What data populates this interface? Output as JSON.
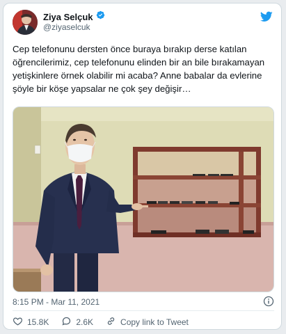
{
  "author": {
    "name": "Ziya Selçuk",
    "handle": "@ziyaselcuk",
    "verified": true
  },
  "tweet": {
    "text": "Cep telefonunu dersten önce buraya bırakıp derse katılan öğrencilerimiz, cep telefonunu elinden bir an bile bırakamayan yetişkinlere örnek olabilir mi acaba? Anne babalar da evlerine şöyle bir köşe yapsalar ne çok şey değişir…",
    "timestamp": "8:15 PM - Mar 11, 2021"
  },
  "actions": {
    "likes": "15.8K",
    "replies": "2.6K",
    "share_label": "Copy link to Tweet"
  },
  "colors": {
    "brand": "#1d9bf0",
    "text_secondary": "#536471"
  },
  "icons": {
    "brand": "twitter-bird-icon",
    "verified": "verified-badge-icon",
    "info": "info-icon",
    "like": "heart-icon",
    "reply": "reply-bubble-icon",
    "share": "link-icon"
  }
}
